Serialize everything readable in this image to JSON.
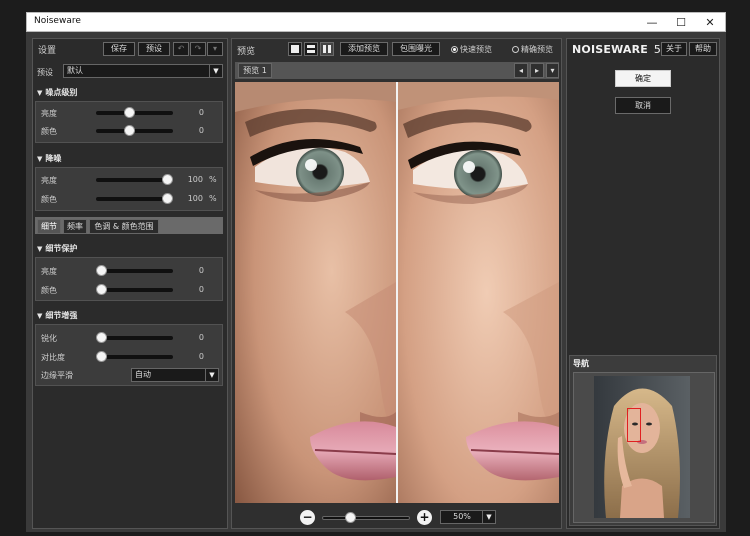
{
  "window": {
    "title": "Noiseware",
    "minimize": "—",
    "maximize": "☐",
    "close": "✕"
  },
  "settings": {
    "title": "设置",
    "save_label": "保存",
    "preset_label": "预设",
    "undo_icon": "undo-icon",
    "redo_icon": "redo-icon",
    "preset_field_label": "预设",
    "preset_value": "默认"
  },
  "noise_level": {
    "title": "噪点级别",
    "rows": [
      {
        "label": "亮度",
        "value": "0",
        "fraction": 0.42
      },
      {
        "label": "颜色",
        "value": "0",
        "fraction": 0.42
      }
    ]
  },
  "noise_reduction": {
    "title": "降噪",
    "rows": [
      {
        "label": "亮度",
        "value": "100",
        "unit": "%",
        "fraction": 1.0
      },
      {
        "label": "颜色",
        "value": "100",
        "unit": "%",
        "fraction": 1.0
      }
    ]
  },
  "tabs": [
    {
      "label": "细节",
      "active": true
    },
    {
      "label": "频率",
      "active": false
    },
    {
      "label": "色调 & 颜色范围",
      "active": false
    }
  ],
  "detail_protection": {
    "title": "细节保护",
    "rows": [
      {
        "label": "亮度",
        "value": "0",
        "fraction": 0.0
      },
      {
        "label": "颜色",
        "value": "0",
        "fraction": 0.0
      }
    ]
  },
  "detail_enhancement": {
    "title": "细节增强",
    "rows": [
      {
        "label": "锐化",
        "value": "0",
        "fraction": 0.0
      },
      {
        "label": "对比度",
        "value": "0",
        "fraction": 0.0
      }
    ],
    "edge_label": "边缘平滑",
    "edge_value": "自动"
  },
  "preview": {
    "title": "预览",
    "add_preview_label": "添加预览",
    "bracket_label": "包围曝光",
    "fast_preview_label": "快速预览",
    "fast_preview_selected": true,
    "accurate_preview_label": "精确预览",
    "accurate_preview_selected": false,
    "tab_label": "预览 1",
    "zoom_value": "50%",
    "zoom_fraction": 0.3
  },
  "right_panel": {
    "brand_main": "NOISEWARE",
    "brand_version": "5",
    "about_label": "关于",
    "help_label": "帮助",
    "ok_label": "确定",
    "cancel_label": "取消",
    "navigator_title": "导航"
  },
  "colors": {
    "background": "#3a3a3a",
    "panel": "#2b2b2b",
    "nav_marker": "#e02020"
  }
}
